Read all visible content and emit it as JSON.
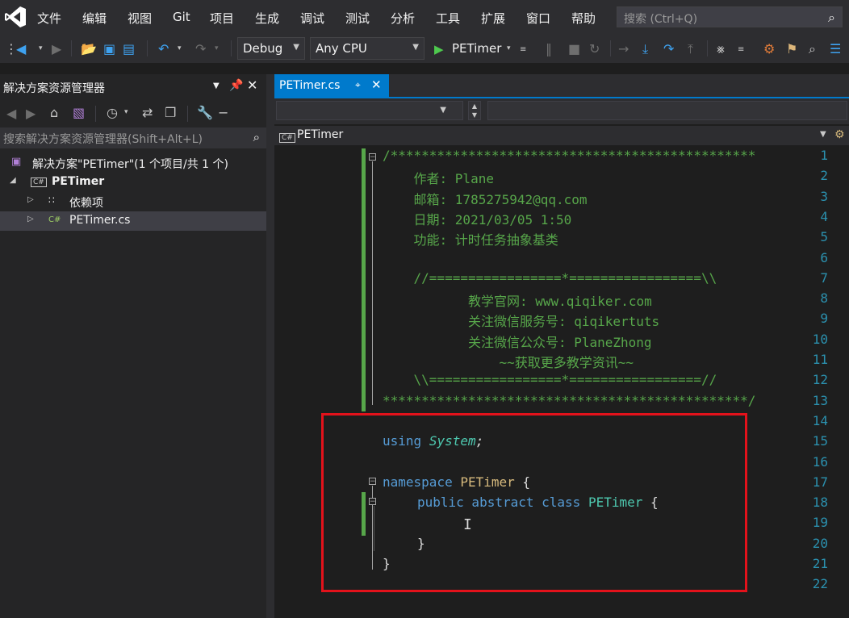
{
  "menubar": {
    "logo_icon": "visual-studio-logo-icon",
    "items": [
      "文件",
      "编辑",
      "视图",
      "Git",
      "项目",
      "生成",
      "调试",
      "测试",
      "分析",
      "工具",
      "扩展",
      "窗口",
      "帮助"
    ],
    "search_placeholder": "搜索 (Ctrl+Q)"
  },
  "toolbar": {
    "config": "Debug",
    "platform": "Any CPU",
    "run_target": "PETimer"
  },
  "solution_explorer": {
    "title": "解决方案资源管理器",
    "search_placeholder": "搜索解决方案资源管理器(Shift+Alt+L)",
    "solution_label": "解决方案\"PETimer\"(1 个项目/共 1 个)",
    "project": "PETimer",
    "dependencies": "依赖项",
    "file": "PETimer.cs",
    "cs_badge": "C#"
  },
  "editor": {
    "tab_label": "PETimer.cs",
    "nav_class": "PETimer",
    "line_numbers": [
      "1",
      "2",
      "3",
      "4",
      "5",
      "6",
      "7",
      "8",
      "9",
      "10",
      "11",
      "12",
      "13",
      "14",
      "15",
      "16",
      "17",
      "18",
      "19",
      "20",
      "21",
      "22"
    ],
    "comment_lines": [
      "/***********************************************",
      "    作者: Plane",
      "    邮箱: 1785275942@qq.com",
      "    日期: 2021/03/05 1:50",
      "    功能: 计时任务抽象基类",
      "",
      "    //=================*=================\\\\",
      "           教学官网: www.qiqiker.com",
      "           关注微信服务号: qiqikertuts",
      "           关注微信公众号: PlaneZhong",
      "               ~~获取更多教学资讯~~",
      "    \\\\=================*=================//",
      "***********************************************/"
    ],
    "code": {
      "using_kw": "using",
      "using_ns": "System",
      "using_end": ";",
      "namespace_kw": "namespace",
      "namespace_name": "PETimer",
      "open_brace": "{",
      "class_mods": "public abstract class",
      "class_name": "PETimer",
      "class_brace": "{",
      "class_close": "}",
      "ns_close": "}"
    }
  },
  "colors": {
    "accent": "#007acc",
    "highlight_box": "#e3121b",
    "comment": "#57a64a",
    "keyword": "#569cd6",
    "type": "#4ec9b0",
    "line_number": "#2b91af"
  }
}
